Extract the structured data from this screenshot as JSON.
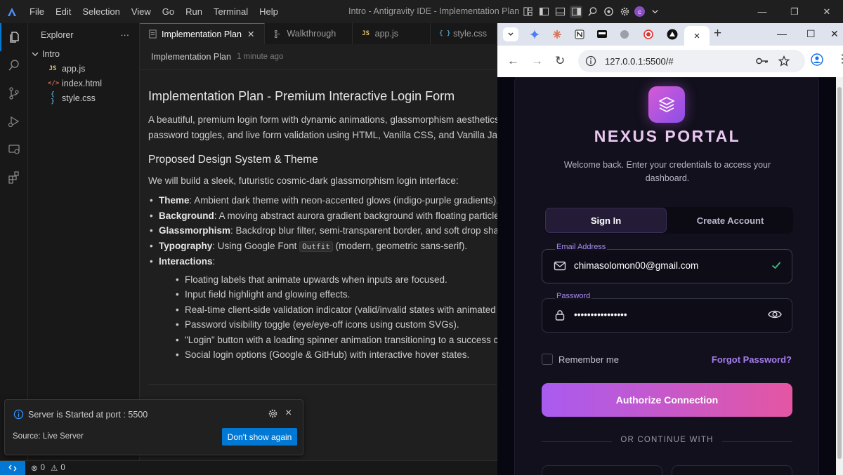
{
  "ide": {
    "menu": [
      "File",
      "Edit",
      "Selection",
      "View",
      "Go",
      "Run",
      "Terminal",
      "Help"
    ],
    "window_title": "Intro - Antigravity IDE - Implementation Plan",
    "account_initial": "c",
    "explorer": {
      "title": "Explorer",
      "folder": "Intro",
      "files": [
        {
          "name": "app.js",
          "icon": "JS",
          "color": "#e8c16b"
        },
        {
          "name": "index.html",
          "icon": "</>",
          "color": "#e06c4c"
        },
        {
          "name": "style.css",
          "icon": "{ }",
          "color": "#519aba"
        }
      ]
    },
    "tabs": [
      {
        "label": "Implementation Plan",
        "active": true
      },
      {
        "label": "Walkthrough",
        "active": false
      },
      {
        "label": "app.js",
        "active": false
      },
      {
        "label": "style.css",
        "active": false
      }
    ],
    "breadcrumb": {
      "name": "Implementation Plan",
      "time": "1 minute ago"
    },
    "doc": {
      "title": "Implementation Plan - Premium Interactive Login Form",
      "intro_1": "A beautiful, premium login form with dynamic animations, glassmorphism aesthetics,",
      "intro_2": "password toggles, and live form validation using HTML, Vanilla CSS, and Vanilla JavaSc",
      "section_title": "Proposed Design System & Theme",
      "section_intro": "We will build a sleek, futuristic cosmic-dark glassmorphism login interface:",
      "bullets": [
        {
          "term": "Theme",
          "text": ": Ambient dark theme with neon-accented glows (indigo-purple gradients)."
        },
        {
          "term": "Background",
          "text": ": A moving abstract aurora gradient background with floating particle"
        },
        {
          "term": "Glassmorphism",
          "text": ": Backdrop blur filter, semi-transparent border, and soft drop shado"
        },
        {
          "term": "Typography",
          "text_before": ": Using Google Font ",
          "code": "Outfit",
          "text_after": " (modern, geometric sans-serif)."
        },
        {
          "term": "Interactions",
          "text": ":"
        }
      ],
      "sub_bullets": [
        "Floating labels that animate upwards when inputs are focused.",
        "Input field highlight and glowing effects.",
        "Real-time client-side validation indicator (valid/invalid states with animated i",
        "Password visibility toggle (eye/eye-off icons using custom SVGs).",
        "\"Login\" button with a loading spinner animation transitioning to a success ch",
        "Social login options (Google & GitHub) with interactive hover states."
      ]
    },
    "notification": {
      "message": "Server is Started at port : 5500",
      "source": "Source: Live Server",
      "button": "Don't show again"
    },
    "status": {
      "errors": "0",
      "warnings": "0"
    }
  },
  "browser": {
    "url": "127.0.0.1:5500/#",
    "active_tab_close": "×"
  },
  "login": {
    "brand": "NEXUS PORTAL",
    "welcome": "Welcome back. Enter your credentials to access your dashboard.",
    "tab_signin": "Sign In",
    "tab_create": "Create Account",
    "email_label": "Email Address",
    "email_value": "chimasolomon00@gmail.com",
    "password_label": "Password",
    "password_value": "••••••••••••••••",
    "remember": "Remember me",
    "forgot": "Forgot Password?",
    "submit": "Authorize Connection",
    "divider": "OR CONTINUE WITH",
    "colors": {
      "accent_start": "#a95bf0",
      "accent_end": "#e456a3",
      "valid": "#3fbf7f"
    }
  }
}
